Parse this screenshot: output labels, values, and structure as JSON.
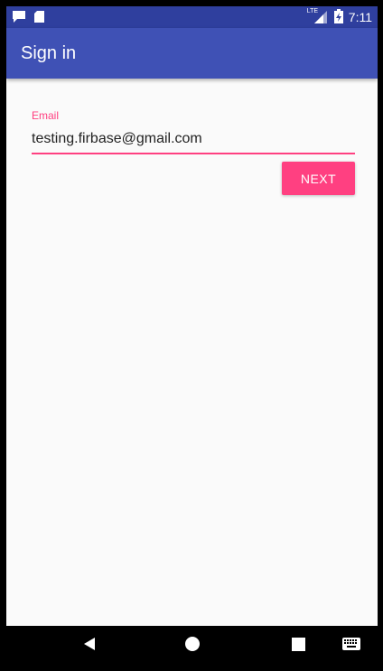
{
  "status_bar": {
    "time": "7:11",
    "network_label": "LTE",
    "icons": [
      "message-notification-icon",
      "sd-card-icon",
      "signal-icon",
      "battery-charging-icon"
    ]
  },
  "app_bar": {
    "title": "Sign in",
    "color": "#3f51b5"
  },
  "form": {
    "email_label": "Email",
    "email_value": "testing.firbase@gmail.com",
    "next_label": "NEXT",
    "accent_color": "#ff4081"
  },
  "nav_bar": {
    "icons": [
      "back-icon",
      "home-icon",
      "recents-icon",
      "keyboard-icon"
    ]
  }
}
